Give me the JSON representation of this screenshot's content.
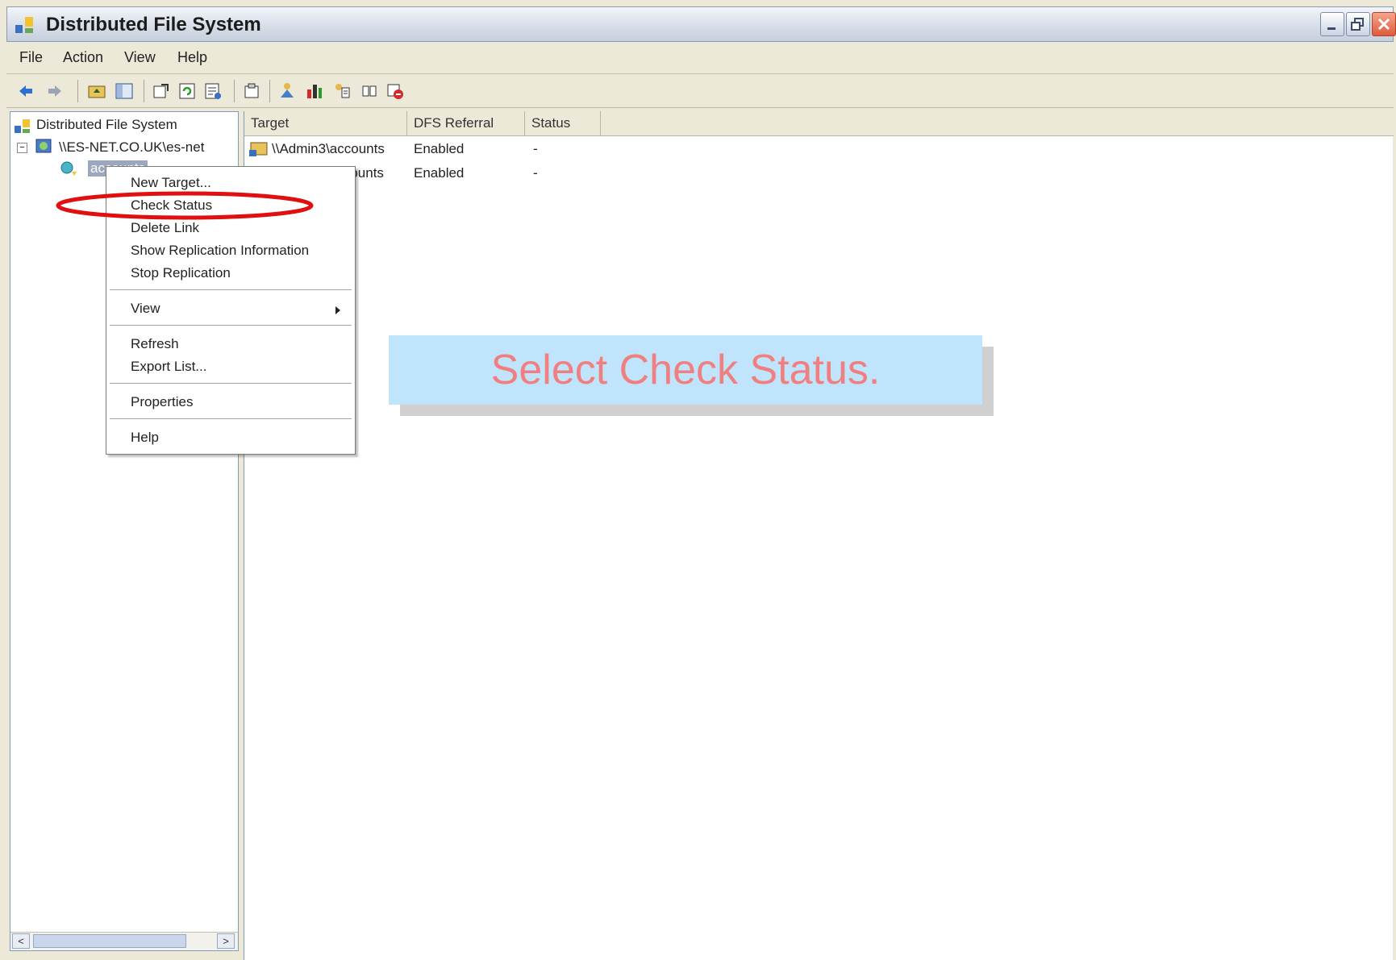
{
  "window": {
    "title": "Distributed File System"
  },
  "menubar": {
    "items": [
      "File",
      "Action",
      "View",
      "Help"
    ]
  },
  "toolbar": {
    "icons": [
      "back-icon",
      "forward-icon",
      "up-folder-icon",
      "show-hide-tree-icon",
      "export-icon",
      "refresh-icon",
      "list-icon",
      "properties-icon",
      "new-root-icon",
      "chart-icon",
      "new-link-icon",
      "check-status-icon",
      "remove-icon"
    ]
  },
  "tree": {
    "root_label": "Distributed File System",
    "namespace_label": "\\\\ES-NET.CO.UK\\es-net",
    "link_label": "accounts"
  },
  "list": {
    "columns": [
      "Target",
      "DFS Referral",
      "Status"
    ],
    "rows": [
      {
        "target": "\\\\Admin3\\accounts",
        "referral": "Enabled",
        "status": "-"
      },
      {
        "target": "\\\\Backup\\accounts",
        "referral": "Enabled",
        "status": "-"
      }
    ]
  },
  "context_menu": {
    "items": [
      "New Target...",
      "Check Status",
      "Delete Link",
      "Show Replication Information",
      "Stop Replication",
      "View",
      "Refresh",
      "Export List...",
      "Properties",
      "Help"
    ]
  },
  "callout": {
    "text": "Select Check Status."
  },
  "colors": {
    "callout_bg": "#bfe4fb",
    "callout_text": "#f08080",
    "highlight": "#e01010"
  }
}
